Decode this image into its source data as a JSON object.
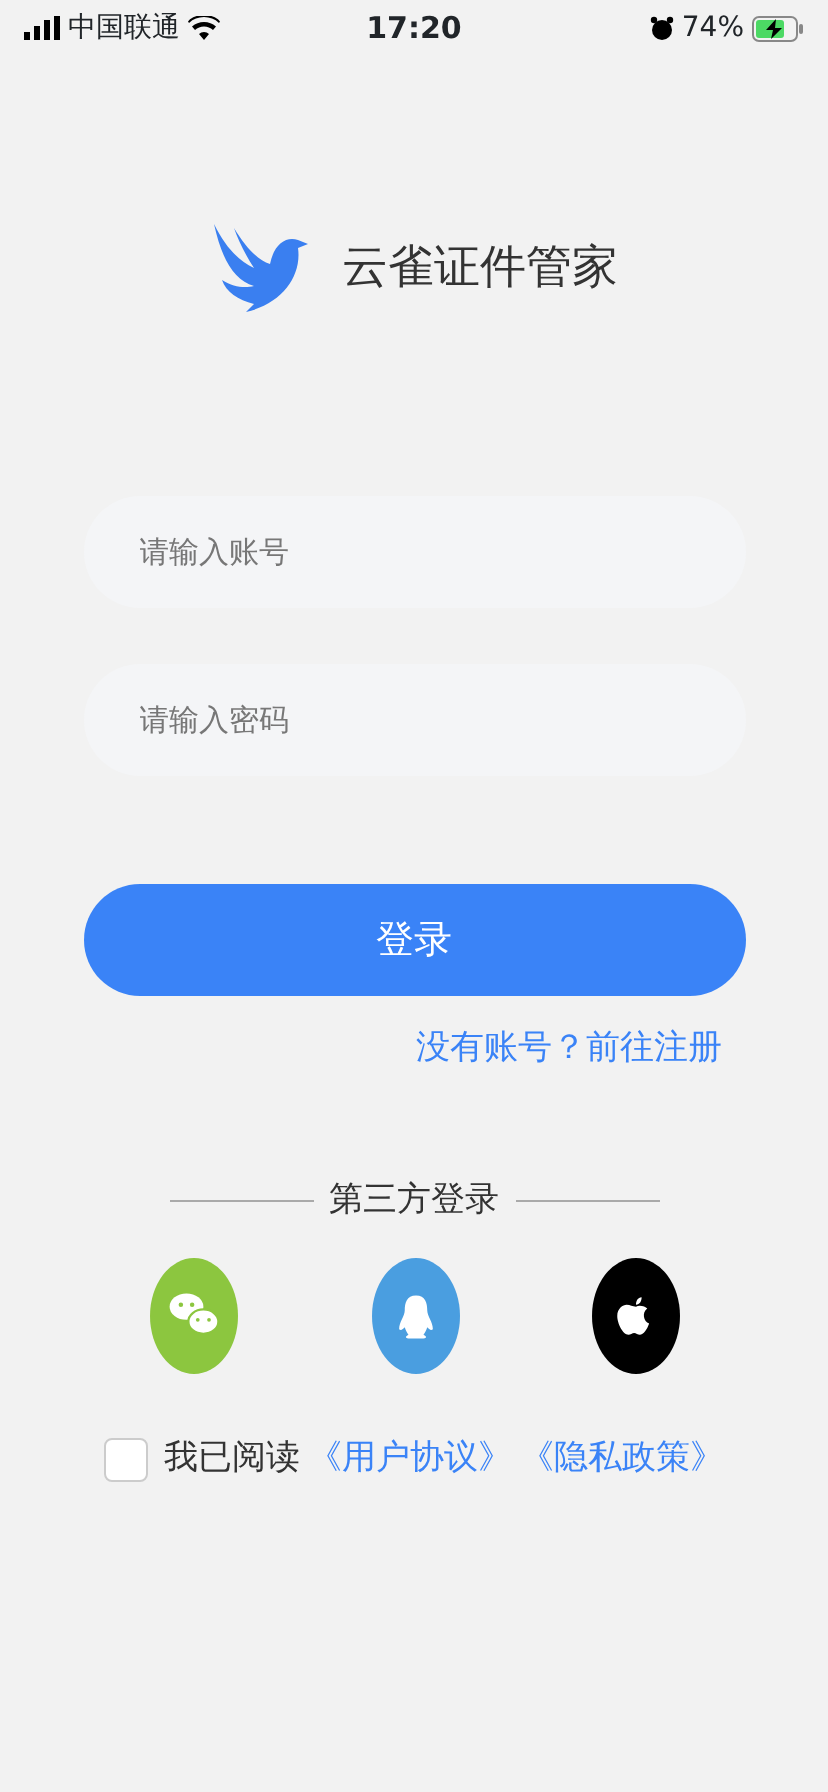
{
  "status_bar": {
    "carrier": "中国联通",
    "time": "17:20",
    "battery": "74%",
    "charging": true
  },
  "app": {
    "name": "云雀证件管家"
  },
  "fields": [
    {
      "placeholder": "请输入账号"
    },
    {
      "placeholder": "请输入密码"
    }
  ],
  "login_button": "登录",
  "register_link": "没有账号？前往注册",
  "third_party": {
    "title": "第三方登录",
    "providers": [
      {
        "kind": "wechat",
        "color": "#8cc63f"
      },
      {
        "kind": "qq",
        "color": "#4a9ee0"
      },
      {
        "kind": "apple",
        "color": "#000000"
      }
    ]
  },
  "agreement": {
    "checked": false,
    "text": "我已阅读",
    "links": [
      "《用户协议》",
      "《隐私政策》"
    ]
  }
}
